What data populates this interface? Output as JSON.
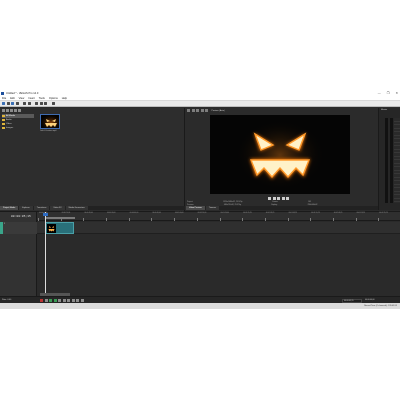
{
  "window": {
    "title": "Untitled * - VEGAS Pro 14.0",
    "controls": [
      "—",
      "❐",
      "✕"
    ]
  },
  "menu": [
    "File",
    "Edit",
    "View",
    "Insert",
    "Tools",
    "Options",
    "Help"
  ],
  "explorer": {
    "tree": [
      {
        "label": "All Media",
        "selected": true
      },
      {
        "label": "Audio"
      },
      {
        "label": "Video"
      },
      {
        "label": "Images"
      }
    ],
    "thumbnail_label": "Jack-O-Lantern.mp4",
    "status_text": "Video: 1920x1080x32, 29.970 fps, 00:00:30;00, Alpha = None   Audio: 48,000 Hz, 16 bit, Stereo, AAC"
  },
  "left_tabs": [
    "Project Media",
    "Explorer",
    "Transitions",
    "Video FX",
    "Media Generators"
  ],
  "preview": {
    "mode_label": "Preview (Auto)",
    "info": [
      {
        "label": "Project:",
        "value": "1920x1080x32, 29.970p"
      },
      {
        "label": "Preview:",
        "value": "480x270x32, 29.970p"
      },
      {
        "label": "Frame:",
        "value": "165"
      },
      {
        "label": "Display:",
        "value": "298x168x32"
      }
    ]
  },
  "right_tabs": [
    "Video Preview",
    "Trimmer"
  ],
  "master": {
    "label": "Master"
  },
  "timeline": {
    "timecode": "00:00:05;15",
    "track_number": "1",
    "ruler_labels": [
      "00:00:00;00",
      "00:00:10;00",
      "00:00:20;00",
      "00:00:30;00",
      "00:00:40;00",
      "00:00:50;00",
      "00:01:00;00",
      "00:01:10;00",
      "00:01:20;00",
      "00:01:29;29",
      "00:01:39;29",
      "00:01:49;29",
      "00:01:59;29",
      "00:02:09;29",
      "00:02:19;29",
      "00:02:29;29"
    ]
  },
  "bottom": {
    "rate": "Rate: 0.00",
    "time": "00:00:05;15",
    "time2": "00:00:00;00"
  },
  "statusbar": {
    "text": "Record Time (2 channels): 139:43:55"
  },
  "colors": {
    "accent": "#3f6bb0",
    "track": "#3aa58a",
    "clip": "#29707a",
    "folder": "#e0b53a",
    "glow": "#ff8a1a"
  }
}
